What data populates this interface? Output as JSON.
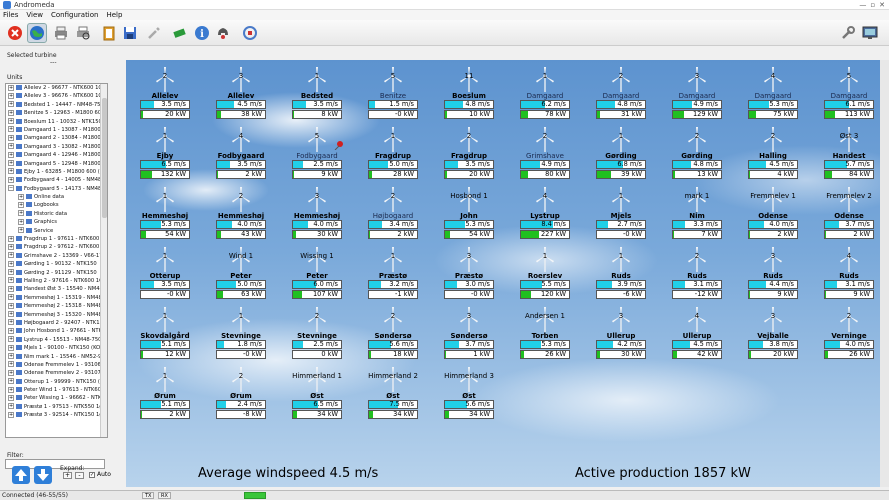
{
  "app": {
    "title": "Andromeda"
  },
  "window": {
    "minimize": "—",
    "maximize": "▫",
    "close": "✕"
  },
  "menu": [
    "Files",
    "View",
    "Configuration",
    "Help"
  ],
  "toolbar": [
    {
      "name": "stop-icon",
      "color": "#e03020"
    },
    {
      "name": "globe-icon",
      "color": "#2a70c8"
    },
    {
      "name": "printer-icon",
      "color": "#777777"
    },
    {
      "name": "print-preview-icon",
      "color": "#888888"
    },
    {
      "name": "clipboard-icon",
      "color": "#e0a030"
    },
    {
      "name": "save-icon",
      "color": "#3a6cc8"
    },
    {
      "name": "tools-icon",
      "color": "#999999"
    },
    {
      "name": "battery-icon",
      "color": "#2a9a3a"
    },
    {
      "name": "info-icon",
      "color": "#3a7ad0"
    },
    {
      "name": "phone-icon",
      "color": "#555555"
    },
    {
      "name": "refresh-icon",
      "color": "#4a7ac8"
    },
    {
      "name": "wrench-icon",
      "color": "#777777"
    },
    {
      "name": "monitor-icon",
      "color": "#4a6a9a"
    }
  ],
  "left": {
    "selected_label": "Selected turbine",
    "selected_value": "---",
    "units_label": "Units",
    "tree": [
      {
        "label": "Allelev 2 - 96677 - NTK600 1Ge",
        "sub": false,
        "exp": "+"
      },
      {
        "label": "Allelev 3 - 96676 - NTK600 1Ge",
        "sub": false,
        "exp": "+"
      },
      {
        "label": "Bedsted 1 - 14447 - NM48-750",
        "sub": false,
        "exp": "+"
      },
      {
        "label": "Benitze 5 - 12963 - M1800 600",
        "sub": false,
        "exp": "+"
      },
      {
        "label": "Boeslum 11 - 10032 - NTK150",
        "sub": false,
        "exp": "+"
      },
      {
        "label": "Damgaard 1 - 13087 - M1800 6",
        "sub": false,
        "exp": "+"
      },
      {
        "label": "Damgaard 2 - 13084 - M1800 6",
        "sub": false,
        "exp": "+"
      },
      {
        "label": "Damgaard 3 - 13082 - M1800 6",
        "sub": false,
        "exp": "+"
      },
      {
        "label": "Damgaard 4 - 12946 - M1800 6",
        "sub": false,
        "exp": "+"
      },
      {
        "label": "Damgaard 5 - 12948 - M1800 6",
        "sub": false,
        "exp": "+"
      },
      {
        "label": "Ejby 1 - 63285 - M1800 600 (M",
        "sub": false,
        "exp": "+"
      },
      {
        "label": "Fodbygaard 4 - 14005 - NM48-",
        "sub": false,
        "exp": "+"
      },
      {
        "label": "Fodbygaard 5 - 14173 - NM48-",
        "sub": false,
        "exp": "−"
      },
      {
        "label": "Online data",
        "sub": true,
        "exp": "+"
      },
      {
        "label": "Logbooks",
        "sub": true,
        "exp": "+"
      },
      {
        "label": "Historic data",
        "sub": true,
        "exp": "+"
      },
      {
        "label": "Graphics",
        "sub": true,
        "exp": "+"
      },
      {
        "label": "Service",
        "sub": true,
        "exp": "+"
      },
      {
        "label": "Fragdrup 1 - 97611 - NTK600",
        "sub": false,
        "exp": "+"
      },
      {
        "label": "Fragdrup 2 - 97612 - NTK600",
        "sub": false,
        "exp": "+"
      },
      {
        "label": "Grimshave 2 - 13369 - V66-175",
        "sub": false,
        "exp": "+"
      },
      {
        "label": "Gørding 1 - 90132 - NTK150",
        "sub": false,
        "exp": "+"
      },
      {
        "label": "Gørding 2 - 91129 - NTK150",
        "sub": false,
        "exp": "+"
      },
      {
        "label": "Halling 2 - 97616 - NTK600 1Ge",
        "sub": false,
        "exp": "+"
      },
      {
        "label": "Handest Øst 3 - 15540 - NM48",
        "sub": false,
        "exp": "+"
      },
      {
        "label": "Hemmeshøj 1 - 15319 - NM48-",
        "sub": false,
        "exp": "+"
      },
      {
        "label": "Hemmeshøj 2 - 15318 - NM48-",
        "sub": false,
        "exp": "+"
      },
      {
        "label": "Hemmeshøj 3 - 15320 - NM48-",
        "sub": false,
        "exp": "+"
      },
      {
        "label": "Højbogaard 2 - 92407 - NTK150",
        "sub": false,
        "exp": "+"
      },
      {
        "label": "John Hosbond 1 - 97661 - NTK",
        "sub": false,
        "exp": "+"
      },
      {
        "label": "Lystrup 4 - 15513 - NM48-750",
        "sub": false,
        "exp": "+"
      },
      {
        "label": "Mjels 1 - 90100 - NTK150 (KO",
        "sub": false,
        "exp": "+"
      },
      {
        "label": "Nim mark 1 - 15546 - NM52-900",
        "sub": false,
        "exp": "+"
      },
      {
        "label": "Odense Fremmelev 1 - 93106",
        "sub": false,
        "exp": "+"
      },
      {
        "label": "Odense Fremmelev 2 - 93107",
        "sub": false,
        "exp": "+"
      },
      {
        "label": "Otterup 1 - 99999 - NTK150 (K",
        "sub": false,
        "exp": "+"
      },
      {
        "label": "Peter Wind 1 - 97613 - NTK600",
        "sub": false,
        "exp": "+"
      },
      {
        "label": "Peter Wissing 1 - 96662 - NTK6",
        "sub": false,
        "exp": "+"
      },
      {
        "label": "Præstø 1 - 97513 - NTK550 1g",
        "sub": false,
        "exp": "+"
      },
      {
        "label": "Præstø 3 - 92514 - NTK150 1g",
        "sub": false,
        "exp": "+"
      }
    ],
    "filter_label": "Filter:",
    "expand_label": "Expand:",
    "expand_plus": "+",
    "expand_minus": "-",
    "auto_label": "Auto",
    "auto_checked": "✓"
  },
  "turbines": [
    {
      "count": "2",
      "name": "Allelev",
      "wind": "3.5 m/s",
      "wind_frac": 0.28,
      "power": "20 kW",
      "power_frac": 0.05,
      "light": false
    },
    {
      "count": "3",
      "name": "Allelev",
      "wind": "4.5 m/s",
      "wind_frac": 0.36,
      "power": "38 kW",
      "power_frac": 0.08,
      "light": false
    },
    {
      "count": "1",
      "name": "Bedsted",
      "wind": "3.5 m/s",
      "wind_frac": 0.28,
      "power": "8 kW",
      "power_frac": 0.03,
      "light": false
    },
    {
      "count": "5",
      "name": "Benitze",
      "wind": "1.5 m/s",
      "wind_frac": 0.12,
      "power": "-0 kW",
      "power_frac": 0.0,
      "light": true
    },
    {
      "count": "11",
      "name": "Boeslum",
      "wind": "4.8 m/s",
      "wind_frac": 0.38,
      "power": "10 kW",
      "power_frac": 0.04,
      "light": false
    },
    {
      "count": "1",
      "name": "Damgaard",
      "wind": "6.2 m/s",
      "wind_frac": 0.5,
      "power": "78 kW",
      "power_frac": 0.14,
      "light": true
    },
    {
      "count": "2",
      "name": "Damgaard",
      "wind": "4.8 m/s",
      "wind_frac": 0.38,
      "power": "31 kW",
      "power_frac": 0.07,
      "light": true
    },
    {
      "count": "3",
      "name": "Damgaard",
      "wind": "4.9 m/s",
      "wind_frac": 0.39,
      "power": "129 kW",
      "power_frac": 0.22,
      "light": true
    },
    {
      "count": "4",
      "name": "Damgaard",
      "wind": "5.3 m/s",
      "wind_frac": 0.42,
      "power": "75 kW",
      "power_frac": 0.14,
      "light": true
    },
    {
      "count": "5",
      "name": "Damgaard",
      "wind": "6.1 m/s",
      "wind_frac": 0.49,
      "power": "113 kW",
      "power_frac": 0.2,
      "light": true
    },
    {
      "count": "1",
      "name": "Ejby",
      "wind": "6.5 m/s",
      "wind_frac": 0.52,
      "power": "132 kW",
      "power_frac": 0.22,
      "light": false
    },
    {
      "count": "4",
      "name": "Fodbygaard",
      "wind": "3.5 m/s",
      "wind_frac": 0.28,
      "power": "2 kW",
      "power_frac": 0.02,
      "light": false
    },
    {
      "count": "5",
      "name": "Fodbygaard",
      "wind": "2.5 m/s",
      "wind_frac": 0.2,
      "power": "9 kW",
      "power_frac": 0.03,
      "light": true
    },
    {
      "count": "1",
      "name": "Fragdrup",
      "wind": "5.0 m/s",
      "wind_frac": 0.4,
      "power": "28 kW",
      "power_frac": 0.06,
      "light": false
    },
    {
      "count": "2",
      "name": "Fragdrup",
      "wind": "3.5 m/s",
      "wind_frac": 0.28,
      "power": "20 kW",
      "power_frac": 0.05,
      "light": false
    },
    {
      "count": "2",
      "name": "Grimshave",
      "wind": "4.9 m/s",
      "wind_frac": 0.39,
      "power": "80 kW",
      "power_frac": 0.14,
      "light": true
    },
    {
      "count": "1",
      "name": "Gørding",
      "wind": "6.8 m/s",
      "wind_frac": 0.54,
      "power": "39 kW",
      "power_frac": 0.3,
      "light": false
    },
    {
      "count": "2",
      "name": "Gørding",
      "wind": "4.8 m/s",
      "wind_frac": 0.38,
      "power": "13 kW",
      "power_frac": 0.04,
      "light": false
    },
    {
      "count": "2",
      "name": "Halling",
      "wind": "4.5 m/s",
      "wind_frac": 0.36,
      "power": "4 kW",
      "power_frac": 0.02,
      "light": false
    },
    {
      "count": "Øst 3",
      "name": "Handest",
      "wind": "5.7 m/s",
      "wind_frac": 0.46,
      "power": "84 kW",
      "power_frac": 0.15,
      "light": false
    },
    {
      "count": "1",
      "name": "Hemmeshøj",
      "wind": "5.3 m/s",
      "wind_frac": 0.42,
      "power": "54 kW",
      "power_frac": 0.1,
      "light": false
    },
    {
      "count": "2",
      "name": "Hemmeshøj",
      "wind": "4.0 m/s",
      "wind_frac": 0.32,
      "power": "43 kW",
      "power_frac": 0.09,
      "light": false
    },
    {
      "count": "3",
      "name": "Hemmeshøj",
      "wind": "4.0 m/s",
      "wind_frac": 0.32,
      "power": "30 kW",
      "power_frac": 0.07,
      "light": false
    },
    {
      "count": "2",
      "name": "Højbogaard",
      "wind": "3.4 m/s",
      "wind_frac": 0.27,
      "power": "2 kW",
      "power_frac": 0.02,
      "light": true
    },
    {
      "count": "Hosbond 1",
      "name": "John",
      "wind": "5.3 m/s",
      "wind_frac": 0.42,
      "power": "54 kW",
      "power_frac": 0.1,
      "light": false
    },
    {
      "count": "4",
      "name": "Lystrup",
      "wind": "8.4 m/s",
      "wind_frac": 0.67,
      "power": "227 kW",
      "power_frac": 0.38,
      "light": false
    },
    {
      "count": "1",
      "name": "Mjels",
      "wind": "2.7 m/s",
      "wind_frac": 0.22,
      "power": "-0 kW",
      "power_frac": 0.0,
      "light": false
    },
    {
      "count": "mark 1",
      "name": "Nim",
      "wind": "3.3 m/s",
      "wind_frac": 0.26,
      "power": "7 kW",
      "power_frac": 0.03,
      "light": false
    },
    {
      "count": "Fremmelev 1",
      "name": "Odense",
      "wind": "4.0 m/s",
      "wind_frac": 0.32,
      "power": "2 kW",
      "power_frac": 0.02,
      "light": false
    },
    {
      "count": "Fremmelev 2",
      "name": "Odense",
      "wind": "3.7 m/s",
      "wind_frac": 0.3,
      "power": "2 kW",
      "power_frac": 0.02,
      "light": false
    },
    {
      "count": "1",
      "name": "Otterup",
      "wind": "3.5 m/s",
      "wind_frac": 0.28,
      "power": "-0 kW",
      "power_frac": 0.0,
      "light": false
    },
    {
      "count": "Wind 1",
      "name": "Peter",
      "wind": "5.0 m/s",
      "wind_frac": 0.4,
      "power": "63 kW",
      "power_frac": 0.12,
      "light": false
    },
    {
      "count": "Wissing 1",
      "name": "Peter",
      "wind": "6.0 m/s",
      "wind_frac": 0.48,
      "power": "107 kW",
      "power_frac": 0.19,
      "light": false
    },
    {
      "count": "1",
      "name": "Præstø",
      "wind": "3.2 m/s",
      "wind_frac": 0.26,
      "power": "-1 kW",
      "power_frac": 0.0,
      "light": false
    },
    {
      "count": "3",
      "name": "Præstø",
      "wind": "3.0 m/s",
      "wind_frac": 0.24,
      "power": "-0 kW",
      "power_frac": 0.0,
      "light": false
    },
    {
      "count": "1",
      "name": "Roerslev",
      "wind": "5.5 m/s",
      "wind_frac": 0.44,
      "power": "120 kW",
      "power_frac": 0.21,
      "light": false
    },
    {
      "count": "1",
      "name": "Ruds",
      "wind": "3.9 m/s",
      "wind_frac": 0.31,
      "power": "-6 kW",
      "power_frac": 0.0,
      "light": false
    },
    {
      "count": "2",
      "name": "Ruds",
      "wind": "3.1 m/s",
      "wind_frac": 0.25,
      "power": "-12 kW",
      "power_frac": 0.0,
      "light": false
    },
    {
      "count": "3",
      "name": "Ruds",
      "wind": "4.4 m/s",
      "wind_frac": 0.35,
      "power": "9 kW",
      "power_frac": 0.03,
      "light": false
    },
    {
      "count": "4",
      "name": "Ruds",
      "wind": "3.1 m/s",
      "wind_frac": 0.25,
      "power": "9 kW",
      "power_frac": 0.03,
      "light": false
    },
    {
      "count": "1",
      "name": "Skovdalgård",
      "wind": "5.1 m/s",
      "wind_frac": 0.41,
      "power": "12 kW",
      "power_frac": 0.04,
      "light": false
    },
    {
      "count": "1",
      "name": "Stevninge",
      "wind": "1.8 m/s",
      "wind_frac": 0.14,
      "power": "-0 kW",
      "power_frac": 0.0,
      "light": false
    },
    {
      "count": "2",
      "name": "Stevninge",
      "wind": "2.5 m/s",
      "wind_frac": 0.2,
      "power": "0 kW",
      "power_frac": 0.0,
      "light": false
    },
    {
      "count": "2",
      "name": "Søndersø",
      "wind": "5.6 m/s",
      "wind_frac": 0.45,
      "power": "18 kW",
      "power_frac": 0.05,
      "light": false
    },
    {
      "count": "3",
      "name": "Søndersø",
      "wind": "3.7 m/s",
      "wind_frac": 0.3,
      "power": "1 kW",
      "power_frac": 0.01,
      "light": false
    },
    {
      "count": "Andersen 1",
      "name": "Torben",
      "wind": "5.3 m/s",
      "wind_frac": 0.42,
      "power": "26 kW",
      "power_frac": 0.06,
      "light": false
    },
    {
      "count": "3",
      "name": "Ullerup",
      "wind": "4.2 m/s",
      "wind_frac": 0.34,
      "power": "30 kW",
      "power_frac": 0.07,
      "light": false
    },
    {
      "count": "4",
      "name": "Ullerup",
      "wind": "4.5 m/s",
      "wind_frac": 0.36,
      "power": "42 kW",
      "power_frac": 0.09,
      "light": false
    },
    {
      "count": "3",
      "name": "Vejballe",
      "wind": "3.8 m/s",
      "wind_frac": 0.3,
      "power": "20 kW",
      "power_frac": 0.05,
      "light": false
    },
    {
      "count": "2",
      "name": "Verninge",
      "wind": "4.0 m/s",
      "wind_frac": 0.32,
      "power": "26 kW",
      "power_frac": 0.06,
      "light": false
    },
    {
      "count": "1",
      "name": "Ørum",
      "wind": "5.1 m/s",
      "wind_frac": 0.41,
      "power": "2 kW",
      "power_frac": 0.02,
      "light": false
    },
    {
      "count": "2",
      "name": "Ørum",
      "wind": "2.4 m/s",
      "wind_frac": 0.19,
      "power": "-8 kW",
      "power_frac": 0.0,
      "light": false
    },
    {
      "count": "Himmerland 1",
      "name": "Øst",
      "wind": "6.5 m/s",
      "wind_frac": 0.52,
      "power": "34 kW",
      "power_frac": 0.08,
      "light": false
    },
    {
      "count": "Himmerland 2",
      "name": "Øst",
      "wind": "7.5 m/s",
      "wind_frac": 0.6,
      "power": "34 kW",
      "power_frac": 0.08,
      "light": false
    },
    {
      "count": "Himmerland 3",
      "name": "Øst",
      "wind": "5.6 m/s",
      "wind_frac": 0.45,
      "power": "34 kW",
      "power_frac": 0.08,
      "light": false
    }
  ],
  "summary": {
    "avg_wind": "Average windspeed 4.5 m/s",
    "active_prod": "Active production 1857 kW"
  },
  "status": {
    "text": "Connected  (46-55/55)",
    "seg1": "TX",
    "seg2": "RX"
  },
  "colors": {
    "wind_fill": "#20d0e8",
    "power_fill": "#20c020",
    "pin": "#d02020"
  }
}
